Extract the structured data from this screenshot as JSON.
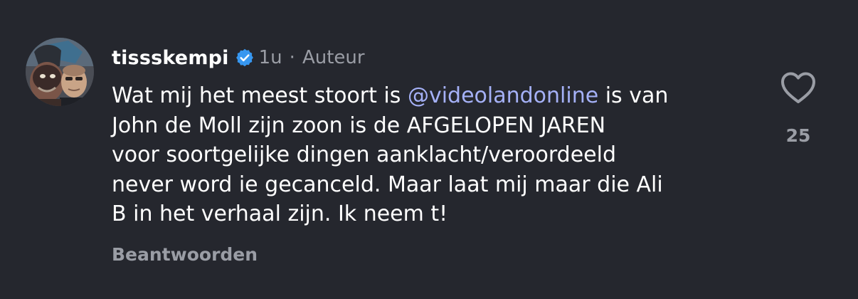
{
  "comment": {
    "username": "tissskempi",
    "time": "1u",
    "separator": "·",
    "role": "Auteur",
    "body_lines": [
      {
        "before": "Wat mij het meest stoort is ",
        "mention": "@videolandonline",
        "after": " is van"
      },
      {
        "text": "John de Moll zijn zoon is de AFGELOPEN JAREN"
      },
      {
        "text": "voor soortgelijke dingen aanklacht/veroordeeld"
      },
      {
        "text": "never word ie gecanceld. Maar laat mij maar die Ali"
      },
      {
        "text": "B in het verhaal zijn. Ik neem t!"
      }
    ],
    "reply_label": "Beantwoorden",
    "like_count": "25"
  },
  "icons": {
    "verified": "verified-badge-icon",
    "like": "heart-outline-icon"
  },
  "colors": {
    "background": "#25272e",
    "text": "#ffffff",
    "secondary": "#9a9da5",
    "mention": "#a5b1f7",
    "verified": "#3797f0"
  }
}
